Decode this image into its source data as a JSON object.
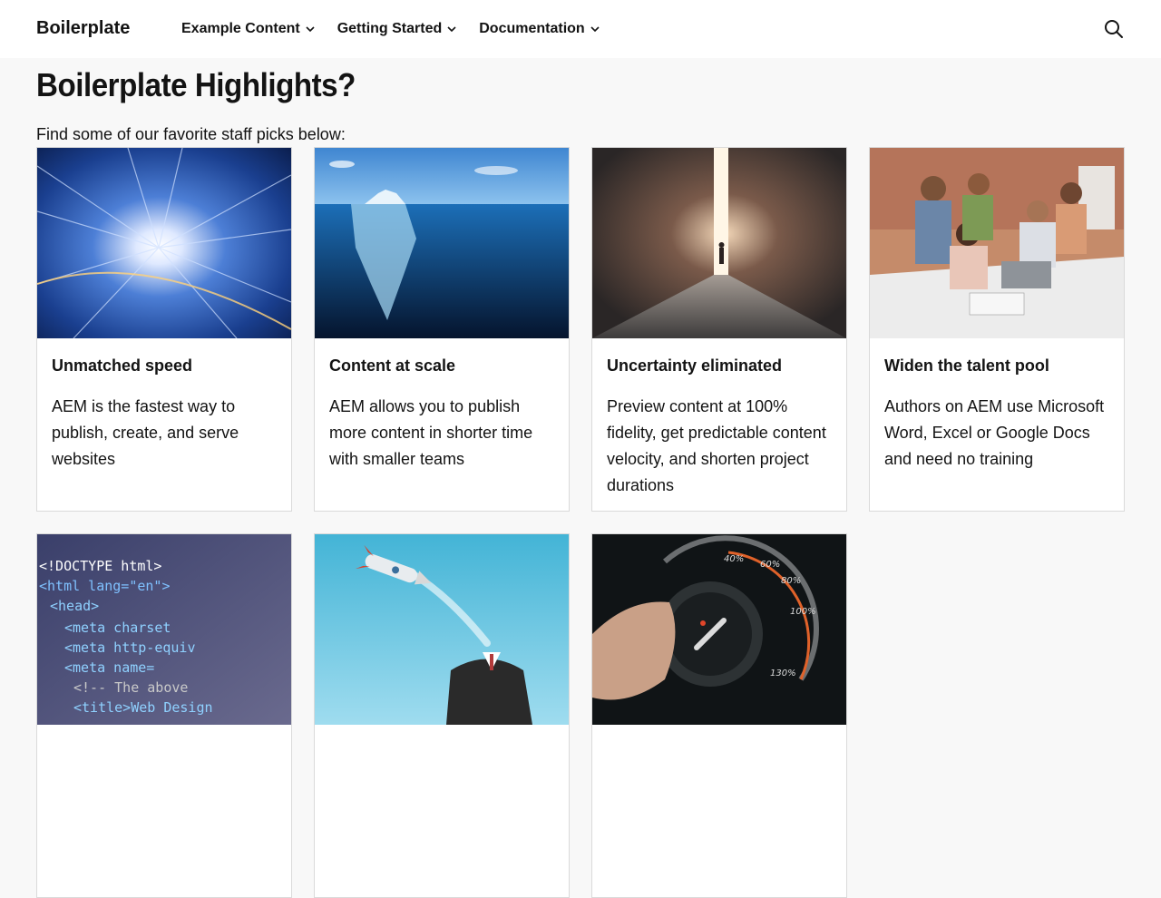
{
  "header": {
    "brand": "Boilerplate",
    "nav": [
      {
        "label": "Example Content"
      },
      {
        "label": "Getting Started"
      },
      {
        "label": "Documentation"
      }
    ],
    "search_icon": "search-icon"
  },
  "main": {
    "title": "Boilerplate Highlights?",
    "intro": "Find some of our favorite staff picks below:",
    "cards": [
      {
        "title": "Unmatched speed",
        "text": "AEM is the fastest way to publish, create, and serve websites",
        "image": "speed-tunnel-image"
      },
      {
        "title": "Content at scale",
        "text": "AEM allows you to publish more content in shorter time with smaller teams",
        "image": "iceberg-image"
      },
      {
        "title": "Uncertainty eliminated",
        "text": "Preview content at 100% fidelity, get predictable content velocity, and shorten project durations",
        "image": "light-doorway-image"
      },
      {
        "title": "Widen the talent pool",
        "text": "Authors on AEM use Microsoft Word, Excel or Google Docs and need no training",
        "image": "team-meeting-image"
      },
      {
        "title": "",
        "text": "",
        "image": "html-code-image"
      },
      {
        "title": "",
        "text": "",
        "image": "rocket-businessman-image"
      },
      {
        "title": "",
        "text": "",
        "image": "speed-dial-image"
      }
    ],
    "code_lines": [
      "<!DOCTYPE html>",
      "<html lang=\"en\">",
      "<head>",
      "<meta charset",
      "<meta http-equiv",
      "<meta name=",
      "<!-- The above",
      "<title>Web Design"
    ],
    "dial_labels": [
      "40%",
      "60%",
      "80%",
      "100%",
      "130%"
    ]
  },
  "colors": {
    "page_bg": "#f8f8f8",
    "header_bg": "#ffffff",
    "text": "#131313",
    "card_border": "#dadada"
  }
}
